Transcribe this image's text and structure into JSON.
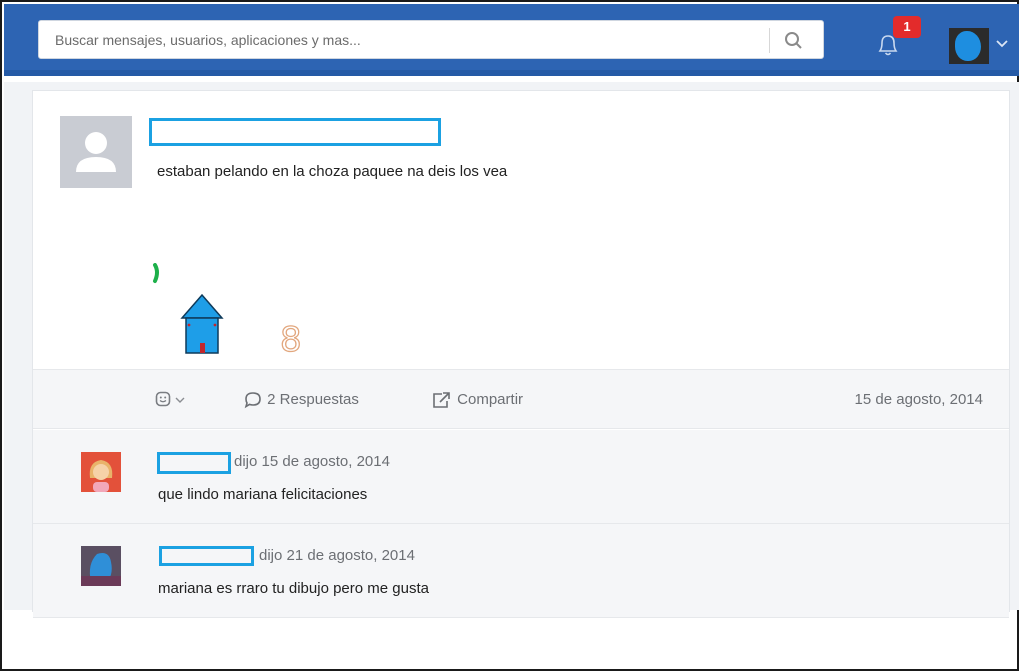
{
  "header": {
    "search_placeholder": "Buscar mensajes, usuarios, aplicaciones y mas...",
    "notification_count": "1",
    "colors": {
      "bar": "#2d64b3",
      "badge": "#e32b2b"
    }
  },
  "post": {
    "text": "estaban pelando en la choza paquee na deis los vea",
    "drawing_icons": [
      "green-stroke",
      "blue-house",
      "eight-digit"
    ],
    "drawing_digit": "8"
  },
  "actions": {
    "replies_label": "2 Respuestas",
    "share_label": "Compartir",
    "date": "15 de agosto, 2014"
  },
  "comments": [
    {
      "meta": "dijo 15 de agosto, 2014",
      "text": "que lindo mariana felicitaciones"
    },
    {
      "meta": "dijo 21 de agosto, 2014",
      "text": "mariana es rraro tu dibujo pero me gusta"
    }
  ]
}
